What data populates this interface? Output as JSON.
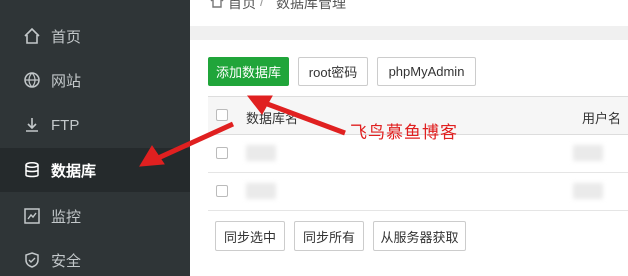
{
  "sidebar": {
    "items": [
      {
        "label": "首页",
        "icon": "home-icon"
      },
      {
        "label": "网站",
        "icon": "globe-icon"
      },
      {
        "label": "FTP",
        "icon": "ftp-icon"
      },
      {
        "label": "数据库",
        "icon": "database-icon",
        "active": true
      },
      {
        "label": "监控",
        "icon": "monitor-icon"
      },
      {
        "label": "安全",
        "icon": "shield-icon"
      }
    ]
  },
  "breadcrumb": {
    "home": "首页",
    "separator": "/",
    "current": "数据库管理"
  },
  "toolbar": {
    "add_db_label": "添加数据库",
    "root_pwd_label": "root密码",
    "phpmyadmin_label": "phpMyAdmin"
  },
  "table": {
    "columns": [
      "数据库名",
      "用户名"
    ]
  },
  "footer_buttons": {
    "sync_selected": "同步选中",
    "sync_all": "同步所有",
    "fetch_from_server": "从服务器获取"
  },
  "watermark": "飞鸟慕鱼博客",
  "colors": {
    "sidebar_bg": "#2f3537",
    "sidebar_active_bg": "#252a2c",
    "accent_green": "#20a53a",
    "annotation_red": "#e02020"
  }
}
